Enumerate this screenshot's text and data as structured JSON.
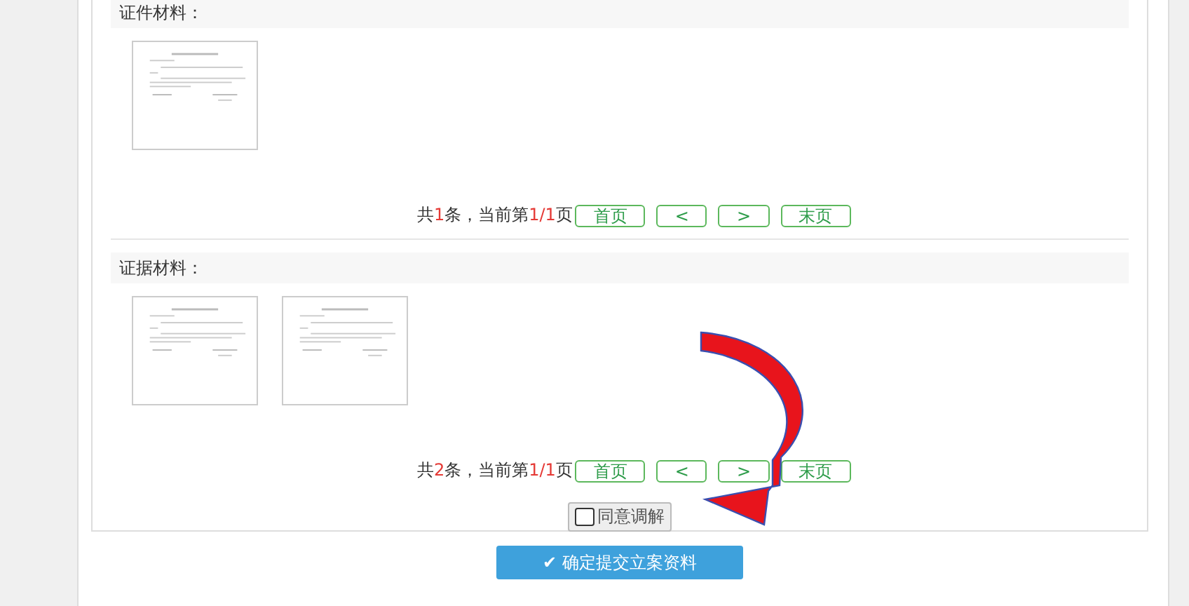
{
  "sections": [
    {
      "title": "证件材料：",
      "pagination": {
        "summary": [
          {
            "kind": "plain",
            "text": "共"
          },
          {
            "kind": "number",
            "text": "1"
          },
          {
            "kind": "plain",
            "text": "条，当前第"
          },
          {
            "kind": "number",
            "text": "1/1"
          },
          {
            "kind": "plain",
            "text": "页"
          }
        ],
        "buttons": [
          "首页",
          "<",
          ">",
          "末页"
        ]
      }
    },
    {
      "title": "证据材料：",
      "pagination": {
        "summary": [
          {
            "kind": "plain",
            "text": "共"
          },
          {
            "kind": "number",
            "text": "2"
          },
          {
            "kind": "plain",
            "text": "条，当前第"
          },
          {
            "kind": "number",
            "text": "1/1"
          },
          {
            "kind": "plain",
            "text": "页"
          }
        ],
        "buttons": [
          "首页",
          "<",
          ">",
          "末页"
        ]
      }
    }
  ],
  "agree_mediation": {
    "label": "同意调解",
    "checked": false
  },
  "submit_button": {
    "icon": "✔",
    "label": "确定提交立案资料"
  }
}
